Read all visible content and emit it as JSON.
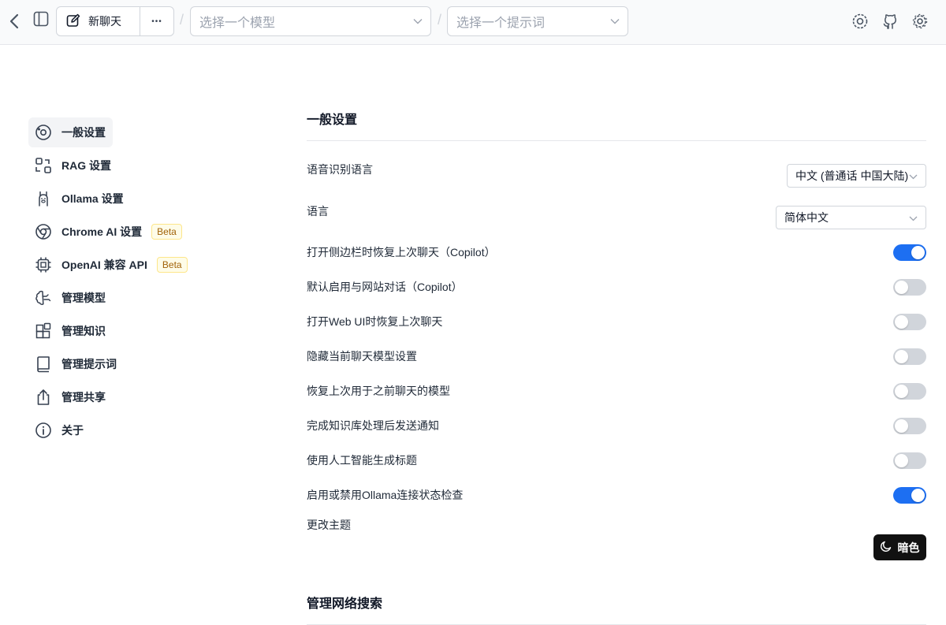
{
  "header": {
    "new_chat_label": "新聊天",
    "more_label": "•••",
    "separator": "/",
    "model_select": {
      "placeholder": "选择一个模型"
    },
    "prompt_select": {
      "placeholder": "选择一个提示词"
    }
  },
  "sidebar": {
    "items": [
      {
        "label": "一般设置",
        "icon": "general-settings-icon",
        "active": true
      },
      {
        "label": "RAG 设置",
        "icon": "rag-icon"
      },
      {
        "label": "Ollama 设置",
        "icon": "ollama-llama-icon"
      },
      {
        "label": "Chrome AI 设置",
        "icon": "chrome-icon",
        "badge": "Beta"
      },
      {
        "label": "OpenAI 兼容 API",
        "icon": "cpu-chip-icon",
        "badge": "Beta"
      },
      {
        "label": "管理模型",
        "icon": "brain-icon"
      },
      {
        "label": "管理知识",
        "icon": "blocks-icon"
      },
      {
        "label": "管理提示词",
        "icon": "book-icon"
      },
      {
        "label": "管理共享",
        "icon": "share-icon"
      },
      {
        "label": "关于",
        "icon": "info-icon"
      }
    ]
  },
  "main": {
    "general_title": "一般设置",
    "speech_lang": {
      "label": "语音识别语言",
      "value": "中文 (普通话 中国大陆)"
    },
    "language": {
      "label": "语言",
      "value": "简体中文"
    },
    "toggles": [
      {
        "label": "打开侧边栏时恢复上次聊天（Copilot）",
        "on": true
      },
      {
        "label": "默认启用与网站对话（Copilot）",
        "on": false
      },
      {
        "label": "打开Web UI时恢复上次聊天",
        "on": false
      },
      {
        "label": "隐藏当前聊天模型设置",
        "on": false
      },
      {
        "label": "恢复上次用于之前聊天的模型",
        "on": false
      },
      {
        "label": "完成知识库处理后发送通知",
        "on": false
      },
      {
        "label": "使用人工智能生成标题",
        "on": false
      },
      {
        "label": "启用或禁用Ollama连接状态检查",
        "on": true
      }
    ],
    "theme": {
      "label": "更改主题",
      "button_label": "暗色"
    },
    "web_search_title": "管理网络搜索"
  },
  "colors": {
    "accent": "#1d6ff2",
    "toggle_off": "#d1d5db",
    "beta_bg": "#fefce8",
    "beta_text": "#a16207",
    "dark_button": "#111111"
  }
}
